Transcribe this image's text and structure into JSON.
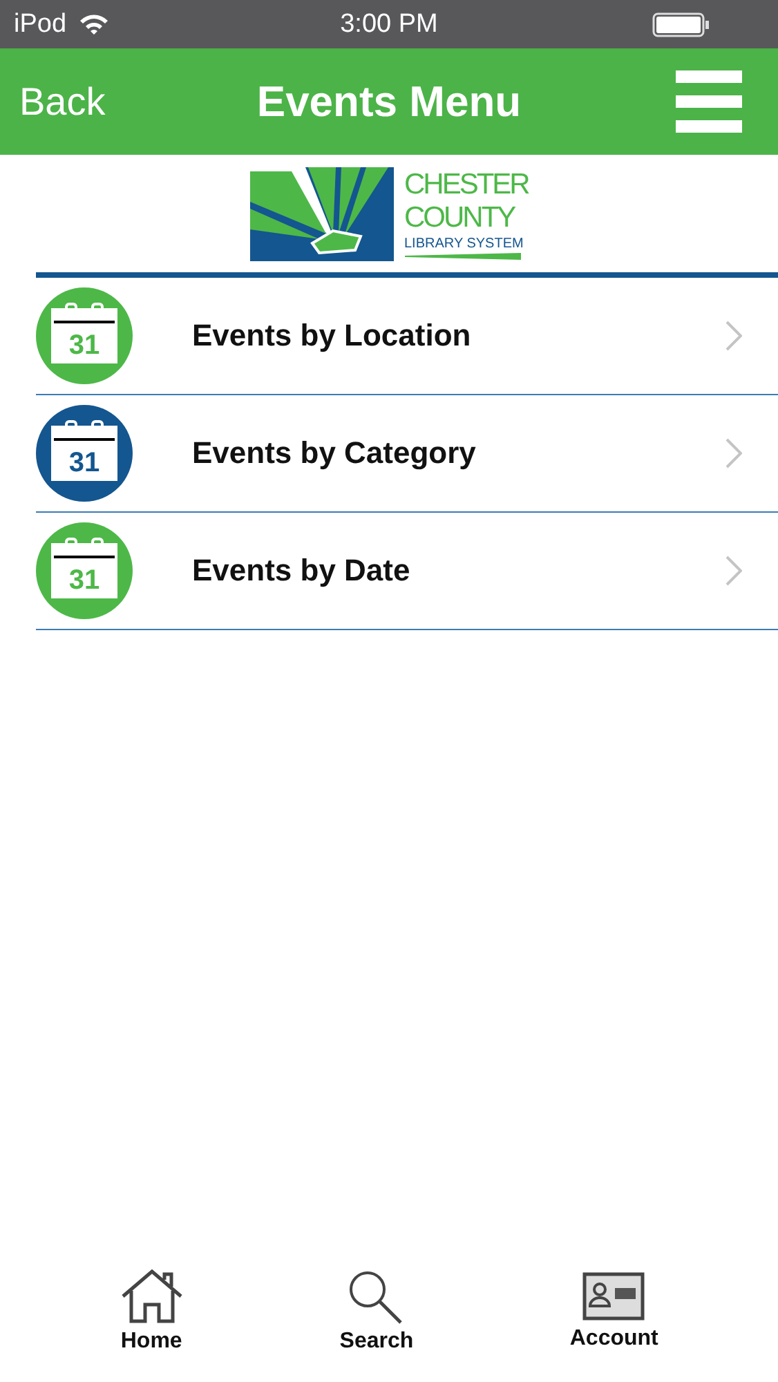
{
  "status_bar": {
    "carrier": "iPod",
    "time": "3:00 PM"
  },
  "nav_bar": {
    "back": "Back",
    "title": "Events Menu"
  },
  "logo": {
    "lines": [
      "CHESTER",
      "COUNTY",
      "LIBRARY SYSTEM"
    ]
  },
  "menu_items": [
    {
      "label": "Events by Location",
      "icon_text": "31",
      "color": "#4db848"
    },
    {
      "label": "Events by Category",
      "icon_text": "31",
      "color": "#14568f"
    },
    {
      "label": "Events by Date",
      "icon_text": "31",
      "color": "#4db848"
    }
  ],
  "tab_bar": [
    {
      "label": "Home",
      "kind": "home"
    },
    {
      "label": "Search",
      "kind": "search"
    },
    {
      "label": "Account",
      "kind": "account"
    }
  ]
}
